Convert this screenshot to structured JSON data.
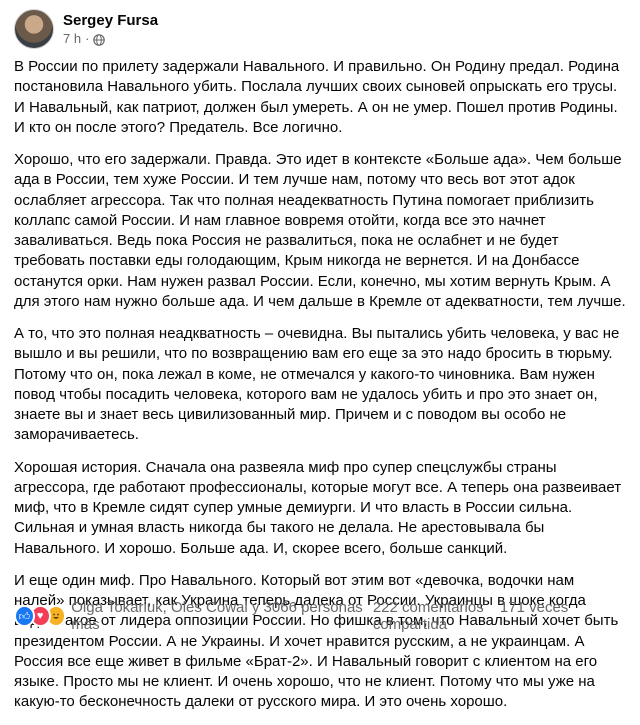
{
  "post": {
    "author": "Sergey Fursa",
    "time": "7 h",
    "separator": "·",
    "privacy_icon": "globe-icon",
    "paragraphs": [
      "В России по прилету задержали Навального. И правильно. Он Родину предал. Родина постановила Навального убить. Послала лучших своих сыновей опрыскать его трусы. И Навальный, как патриот, должен был умереть. А он не умер. Пошел против Родины. И кто он после этого? Предатель. Все логично.",
      "Хорошо, что его задержали. Правда. Это идет в контексте «Больше ада». Чем больше ада в России, тем хуже России. И тем лучше нам, потому что весь вот этот адок ослабляет агрессора. Так что полная неадекватность Путина помогает приблизить коллапс самой России. И нам главное вовремя отойти, когда все это начнет заваливаться. Ведь пока Россия не развалиться, пока не ослабнет и не будет требовать поставки еды голодающим, Крым никогда не вернется. И на Донбассе останутся орки. Нам нужен развал России. Если, конечно, мы хотим вернуть Крым. А для этого нам нужно больше ада. И чем дальше в Кремле от адекватности, тем лучше.",
      "А то, что это полная неадкватность – очевидна. Вы пытались убить человека, у вас не вышло и вы решили, что по возвращению вам его еще за это надо бросить в тюрьму. Потому что он, пока лежал в коме, не отмечался у какого-то чиновника. Вам нужен повод чтобы посадить человека, которого вам не удалось убить и про это знает он, знаете вы и знает весь цивилизованный мир. Причем и с поводом вы особо не заморачиваетесь.",
      "Хорошая история. Сначала она развеяла миф про супер спецслужбы страны агрессора, где работают профессионалы, которые могут все. А теперь она развеивает миф, что в Кремле сидят супер умные демиурги. И что власть в России сильна. Сильная и умная власть никогда бы такого не делала. Не арестовывала бы Навального. И хорошо. Больше ада. И, скорее всего, больше санкций.",
      "И еще один миф. Про Навального. Который вот этим вот «девочка, водочки нам налей» показывает, как Украина теперь далека от России. Украинцы в шоке когда видят такое от лидера оппозиции России. Но фишка в том, что Навальный хочет быть президентом России. А не Украины. И хочет нравится русским, а не украинцам. А Россия все еще живет в фильме «Брат-2». И Навальный говорит с клиентом на его языке. Просто мы не клиент. И очень хорошо, что не клиент. Потому что мы уже на какую-то бесконечность далеки от русского мира. И это очень хорошо."
    ]
  },
  "footer": {
    "reaction_icons": [
      "like-icon",
      "love-icon",
      "haha-icon"
    ],
    "reactors": "Olga Tokariuk, Oles Cowal y 3066 personas más",
    "comments": "222 comentarios",
    "shares": "171 veces compartida"
  },
  "colors": {
    "text": "#050505",
    "secondary": "#65676b",
    "like": "#1877f2",
    "love": "#f33e58",
    "haha": "#f7b125"
  }
}
